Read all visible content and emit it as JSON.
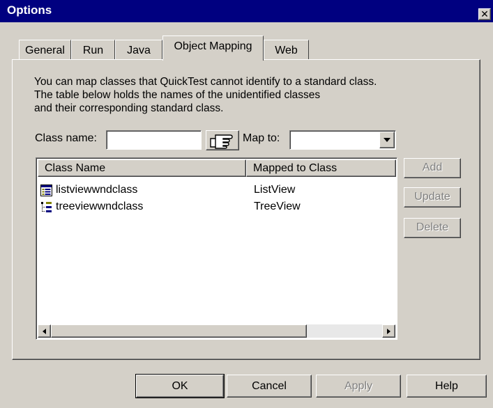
{
  "window": {
    "title": "Options"
  },
  "tabs": [
    "General",
    "Run",
    "Java",
    "Object Mapping",
    "Web"
  ],
  "description": [
    "You can map classes that QuickTest cannot identify to a standard class.",
    "The table below holds the names of the unidentified classes",
    "and their corresponding standard class."
  ],
  "form": {
    "class_name_label": "Class name:",
    "class_name_value": "",
    "map_to_label": "Map to:",
    "map_to_value": ""
  },
  "table": {
    "columns": [
      "Class Name",
      "Mapped to Class"
    ],
    "rows": [
      {
        "name": "listviewwndclass",
        "mapped": "ListView",
        "icon": "listview-icon"
      },
      {
        "name": "treeviewwndclass",
        "mapped": "TreeView",
        "icon": "treeview-icon"
      }
    ]
  },
  "side_buttons": {
    "add": "Add",
    "update": "Update",
    "delete": "Delete"
  },
  "footer_buttons": {
    "ok": "OK",
    "cancel": "Cancel",
    "apply": "Apply",
    "help": "Help"
  },
  "icons": {
    "close": "close-icon",
    "pointer": "pointing-hand-icon",
    "dropdown": "chevron-down-icon",
    "scroll_left": "arrow-left-icon",
    "scroll_right": "arrow-right-icon"
  }
}
